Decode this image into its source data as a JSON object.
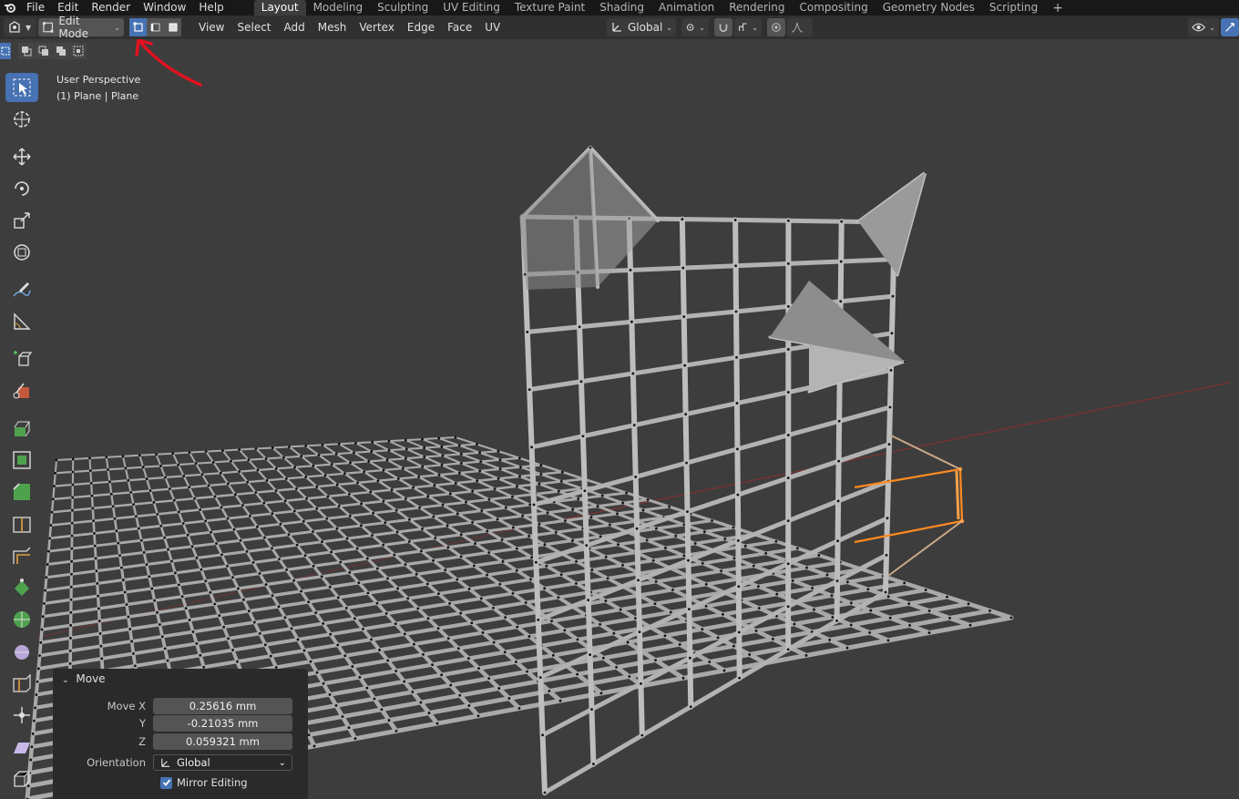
{
  "menubar": {
    "items": [
      "File",
      "Edit",
      "Render",
      "Window",
      "Help"
    ],
    "workspaces": [
      "Layout",
      "Modeling",
      "Sculpting",
      "UV Editing",
      "Texture Paint",
      "Shading",
      "Animation",
      "Rendering",
      "Compositing",
      "Geometry Nodes",
      "Scripting"
    ],
    "active_workspace": "Layout",
    "add_tab": "+"
  },
  "header": {
    "mode": "Edit Mode",
    "menus": [
      "View",
      "Select",
      "Add",
      "Mesh",
      "Vertex",
      "Edge",
      "Face",
      "UV"
    ],
    "transform_orientation": "Global",
    "active_select_mode": "vertex"
  },
  "viewport": {
    "view_name": "User Perspective",
    "object_info": "(1) Plane | Plane",
    "colors": {
      "background": "#3d3d3d",
      "wire": "#a9a9a9",
      "selected": "#ff8a1f",
      "annotation": "#e0121f",
      "x_axis": "#8c2f2f"
    }
  },
  "operator_panel": {
    "title": "Move",
    "fields": [
      {
        "label": "Move X",
        "value": "0.25616 mm"
      },
      {
        "label": "Y",
        "value": "-0.21035 mm"
      },
      {
        "label": "Z",
        "value": "0.059321 mm"
      }
    ],
    "orientation_label": "Orientation",
    "orientation_value": "Global",
    "mirror_label": "Mirror Editing",
    "mirror_checked": true
  },
  "toolbar": {
    "tools": [
      "select-box",
      "cursor",
      "move",
      "rotate",
      "scale",
      "transform",
      "annotate",
      "measure",
      "add-cube",
      "knife-select",
      "extrude",
      "inset",
      "bevel",
      "loop-cut",
      "offset-edge-loop",
      "poly-build",
      "spin",
      "smooth",
      "edge-slide",
      "shrink-fatten",
      "shear",
      "rip",
      "cube-project"
    ],
    "active_tool": "select-box"
  }
}
